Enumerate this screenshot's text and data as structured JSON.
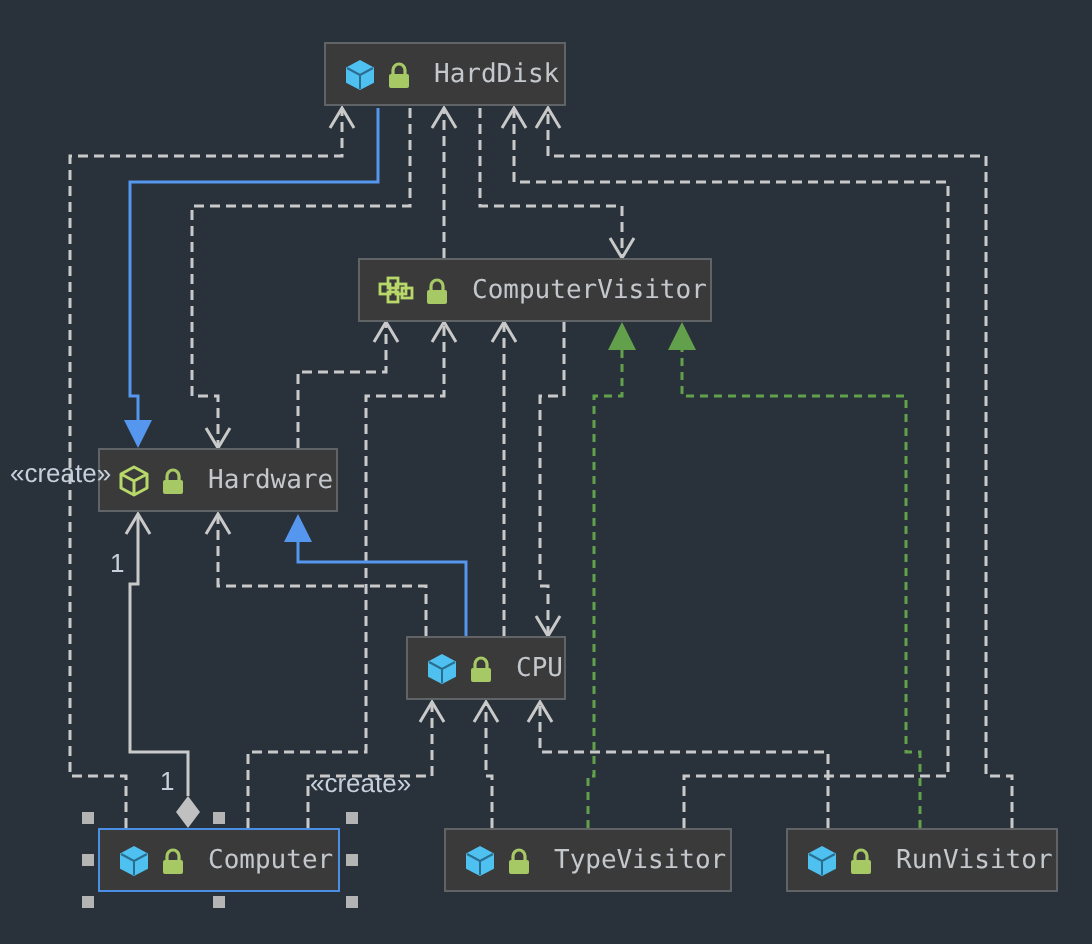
{
  "nodes": [
    {
      "name": "HardDisk",
      "kind": "class",
      "selected": false
    },
    {
      "name": "ComputerVisitor",
      "kind": "interface",
      "selected": false
    },
    {
      "name": "Hardware",
      "kind": "abstract",
      "selected": false
    },
    {
      "name": "CPU",
      "kind": "class",
      "selected": false
    },
    {
      "name": "Computer",
      "kind": "class",
      "selected": true
    },
    {
      "name": "TypeVisitor",
      "kind": "class",
      "selected": false
    },
    {
      "name": "RunVisitor",
      "kind": "class",
      "selected": false
    }
  ],
  "relations": [
    {
      "kind": "dependency",
      "label": "«create»"
    },
    {
      "kind": "inheritance"
    },
    {
      "kind": "dependency"
    },
    {
      "kind": "dependency"
    },
    {
      "kind": "dependency"
    },
    {
      "kind": "dependency"
    },
    {
      "kind": "dependency"
    },
    {
      "kind": "dependency"
    },
    {
      "kind": "dependency"
    },
    {
      "kind": "dependency"
    },
    {
      "kind": "dependency"
    },
    {
      "kind": "implementation"
    },
    {
      "kind": "implementation"
    },
    {
      "kind": "dependency"
    },
    {
      "kind": "inheritance"
    },
    {
      "kind": "composition",
      "source_multiplicity": "1",
      "target_multiplicity": "1"
    },
    {
      "kind": "dependency",
      "label": "«create»"
    },
    {
      "kind": "dependency"
    },
    {
      "kind": "dependency"
    }
  ]
}
